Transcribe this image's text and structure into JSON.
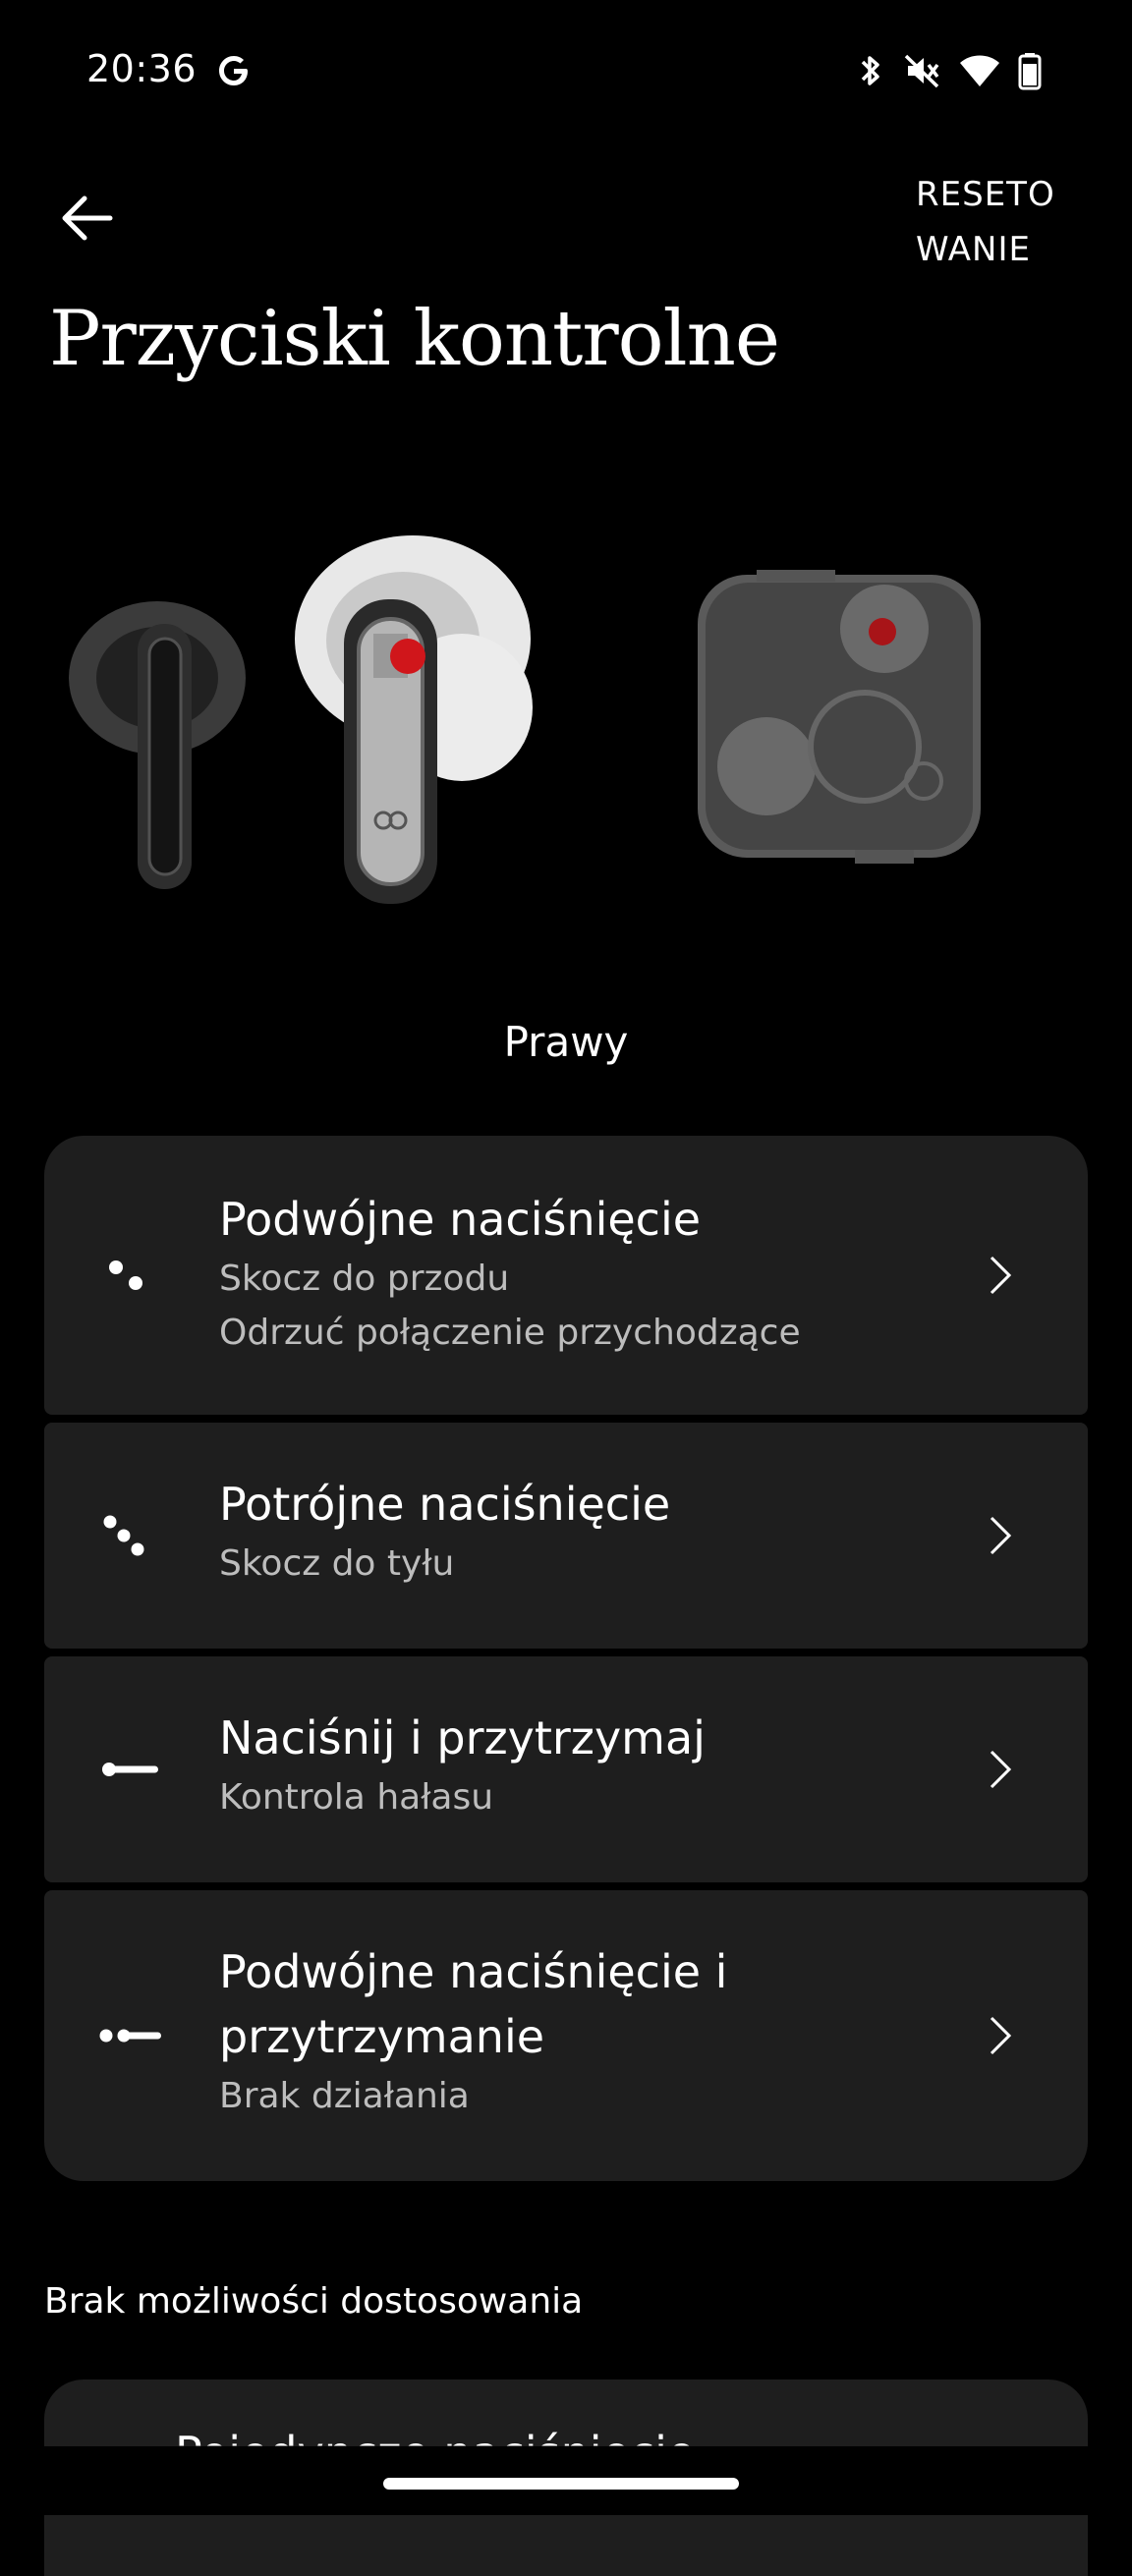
{
  "status_bar": {
    "time": "20:36",
    "icons": [
      "google-g-icon",
      "bluetooth-icon",
      "mute-icon",
      "wifi-icon",
      "battery-icon"
    ]
  },
  "header": {
    "reset_label": "RESETO\nWANIE",
    "title": "Przyciski kontrolne"
  },
  "device": {
    "selected_side": "Prawy"
  },
  "controls": [
    {
      "title": "Podwójne naciśnięcie",
      "subtitle_1": "Skocz do przodu",
      "subtitle_2": "Odrzuć połączenie przychodzące",
      "icon": "double-tap-icon"
    },
    {
      "title": "Potrójne naciśnięcie",
      "subtitle_1": "Skocz do tyłu",
      "icon": "triple-tap-icon"
    },
    {
      "title": "Naciśnij i przytrzymaj",
      "subtitle_1": "Kontrola hałasu",
      "icon": "press-hold-icon"
    },
    {
      "title_1": "Podwójne naciśnięcie i",
      "title_2": "przytrzymanie",
      "subtitle_1": "Brak działania",
      "icon": "double-tap-hold-icon"
    }
  ],
  "non_customizable": {
    "label": "Brak możliwości dostosowania",
    "partial_item": "Pojedyncze naciśnięcie"
  },
  "colors": {
    "background": "#000000",
    "card": "#1e1e1e",
    "accent_red": "#d0161b"
  }
}
